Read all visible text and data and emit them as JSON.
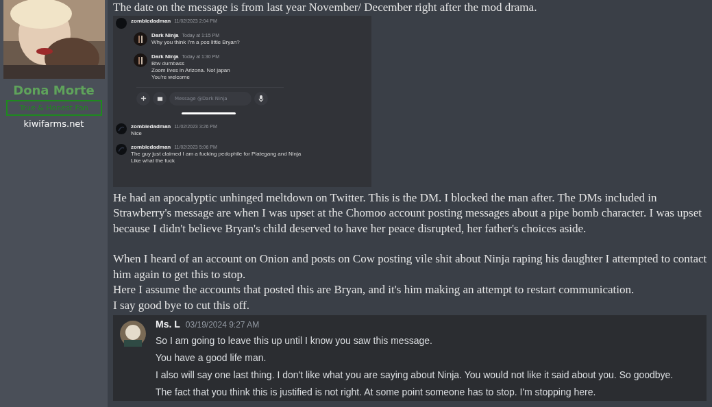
{
  "author": {
    "name": "Dona Morte",
    "title": "True & Honest Fan",
    "site": "kiwifarms.net"
  },
  "post": {
    "intro": "The date on the message is from last year November/ December right after the mod drama.",
    "screenshot": {
      "top_message": {
        "user": "zombiedadman",
        "time": "11/02/2023 2:04 PM"
      },
      "quoted": [
        {
          "user": "Dark Ninja",
          "time": "Today at 1:15 PM",
          "lines": [
            "Why you think I'm a pos little Bryan?"
          ]
        },
        {
          "user": "Dark Ninja",
          "time": "Today at 1:30 PM",
          "lines": [
            "Btw dumbass",
            "Zoom lives in Arizona. Not japan",
            "You're welcome"
          ]
        }
      ],
      "composer": {
        "placeholder": "Message @Dark Ninja"
      },
      "messages": [
        {
          "user": "zombiedadman",
          "time": "11/02/2023 3:26 PM",
          "lines": [
            "Nice"
          ]
        },
        {
          "user": "zombiedadman",
          "time": "11/02/2023 5:06 PM",
          "lines": [
            "The guy just claimed I am a fucking pedophile for Plategang and Ninja",
            "Like what the fuck"
          ]
        }
      ]
    },
    "paragraphs": [
      [
        "He had an apocalyptic unhinged meltdown on Twitter. This is the DM. I blocked the man after. The DMs included in Strawberry's message are when I was upset at the Chomoo account posting messages about a pipe bomb character. I was upset because I didn't believe Bryan's child deserved to have her peace disrupted, her father's choices aside."
      ],
      [
        "When I heard of an account on Onion and posts on Cow posting vile shit about Ninja raping his daughter I attempted to contact him again to get this to stop.",
        "Here I assume the accounts that posted this are Bryan, and it's him making an attempt to restart communication.",
        "I say good bye to cut this off."
      ]
    ],
    "embed": {
      "user": "Ms. L",
      "time": "03/19/2024 9:27 AM",
      "lines": [
        "So I am going to leave this up until I know you saw this message.",
        "You have a good life man.",
        "I also will say one last thing.  I don't like what you are saying about Ninja.  You would not like it said about you.  So goodbye.",
        "The fact that you think this is justified is not right.  At some point someone has to stop.  I'm stopping here."
      ]
    }
  }
}
